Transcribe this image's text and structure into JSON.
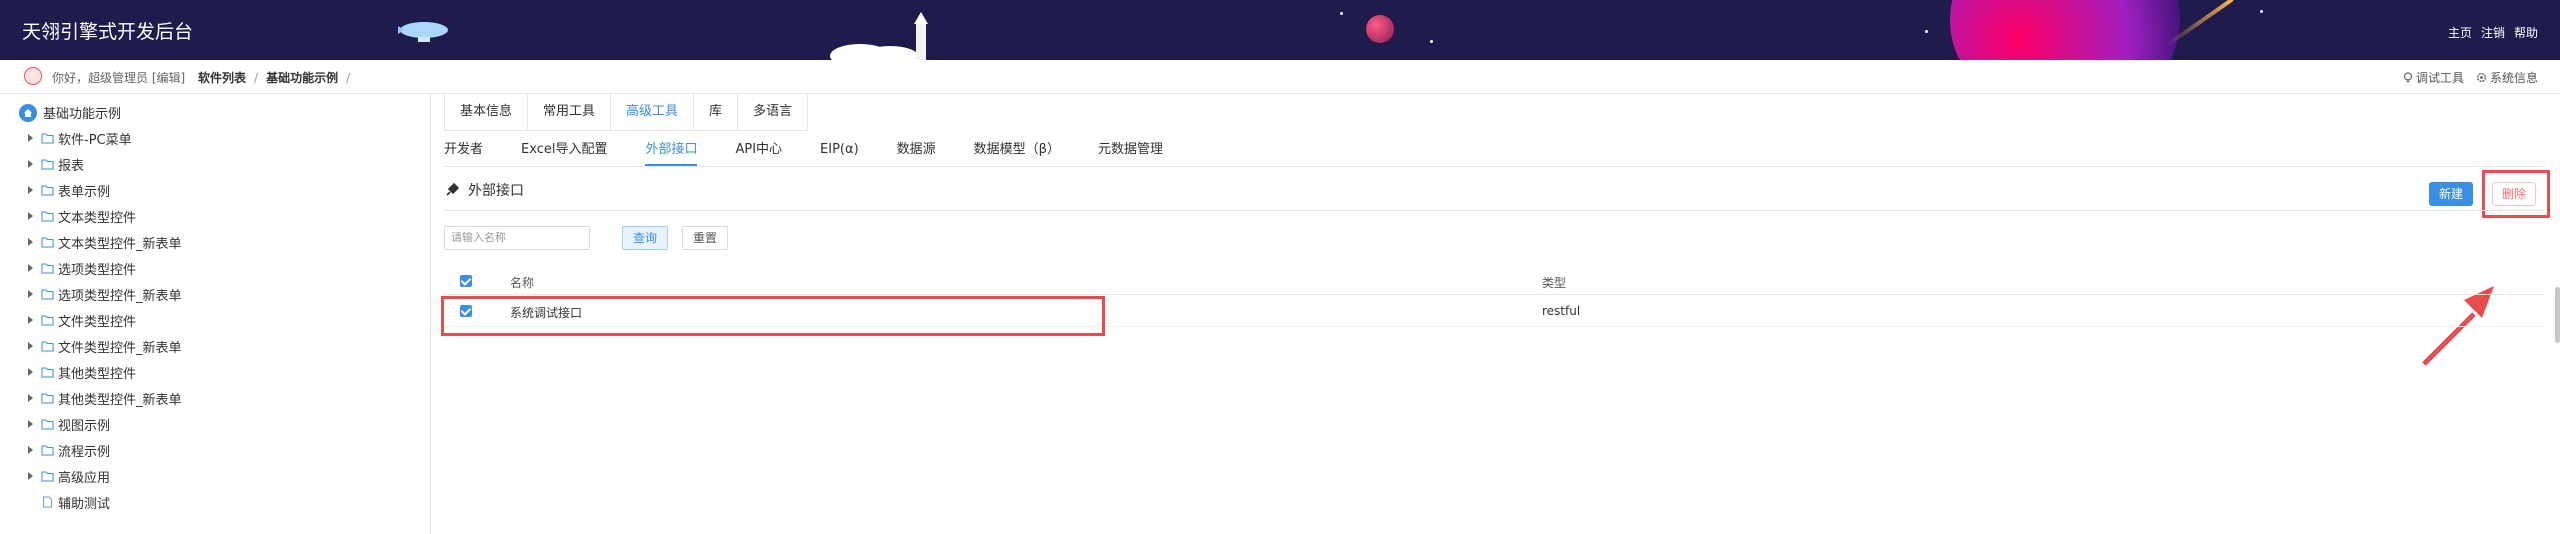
{
  "app": {
    "title": "天翎引擎式开发后台"
  },
  "topnav": [
    "主页",
    "注销",
    "帮助"
  ],
  "user": {
    "greeting": "你好，超级管理员 [编辑]"
  },
  "breadcrumb": {
    "items": [
      "软件列表",
      "基础功能示例"
    ],
    "sep": "/"
  },
  "tools": {
    "debug": "调试工具",
    "sysinfo": "系统信息"
  },
  "sidebar": {
    "root": "基础功能示例",
    "items": [
      {
        "label": "软件-PC菜单",
        "icon": "folder-icon",
        "expandable": true
      },
      {
        "label": "报表",
        "icon": "folder-icon",
        "expandable": true
      },
      {
        "label": "表单示例",
        "icon": "folder-icon",
        "expandable": true
      },
      {
        "label": "文本类型控件",
        "icon": "folder-icon",
        "expandable": true
      },
      {
        "label": "文本类型控件_新表单",
        "icon": "folder-icon",
        "expandable": true
      },
      {
        "label": "选项类型控件",
        "icon": "folder-icon",
        "expandable": true
      },
      {
        "label": "选项类型控件_新表单",
        "icon": "folder-icon",
        "expandable": true
      },
      {
        "label": "文件类型控件",
        "icon": "folder-icon",
        "expandable": true
      },
      {
        "label": "文件类型控件_新表单",
        "icon": "folder-icon",
        "expandable": true
      },
      {
        "label": "其他类型控件",
        "icon": "folder-icon",
        "expandable": true
      },
      {
        "label": "其他类型控件_新表单",
        "icon": "folder-icon",
        "expandable": true
      },
      {
        "label": "视图示例",
        "icon": "folder-icon",
        "expandable": true
      },
      {
        "label": "流程示例",
        "icon": "folder-icon",
        "expandable": true
      },
      {
        "label": "高级应用",
        "icon": "folder-icon",
        "expandable": true
      },
      {
        "label": "辅助测试",
        "icon": "file-icon",
        "expandable": false
      }
    ]
  },
  "tabs1": [
    {
      "label": "基本信息",
      "active": false
    },
    {
      "label": "常用工具",
      "active": false
    },
    {
      "label": "高级工具",
      "active": true
    },
    {
      "label": "库",
      "active": false
    },
    {
      "label": "多语言",
      "active": false
    }
  ],
  "tabs2": [
    {
      "label": "开发者",
      "active": false
    },
    {
      "label": "Excel导入配置",
      "active": false
    },
    {
      "label": "外部接口",
      "active": true
    },
    {
      "label": "API中心",
      "active": false
    },
    {
      "label": "EIP(α)",
      "active": false
    },
    {
      "label": "数据源",
      "active": false
    },
    {
      "label": "数据模型（β）",
      "active": false
    },
    {
      "label": "元数据管理",
      "active": false
    }
  ],
  "panel": {
    "title": "外部接口",
    "new_label": "新建",
    "delete_label": "删除"
  },
  "search": {
    "placeholder": "请输入名称",
    "query_label": "查询",
    "reset_label": "重置"
  },
  "table": {
    "headers": [
      "名称",
      "类型"
    ],
    "rows": [
      {
        "name": "系统调试接口",
        "type": "restful",
        "checked": true
      }
    ]
  },
  "colors": {
    "header_bg": "#1f1b4d",
    "accent": "#3a8ee6",
    "danger": "#f56c6c",
    "highlight": "#e84c4c"
  }
}
